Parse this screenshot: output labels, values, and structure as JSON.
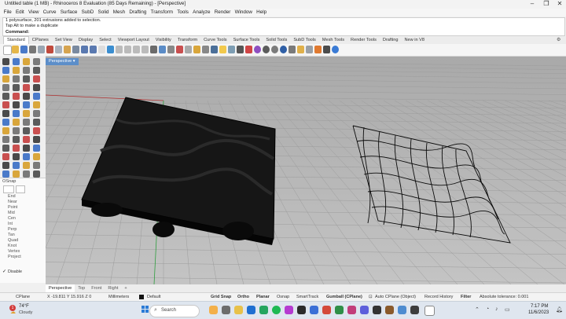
{
  "window": {
    "title": "Untitled table (1 MB) - Rhinoceros 8 Evaluation (85 Days Remaining) - [Perspective]",
    "controls": [
      "–",
      "❐",
      "✕"
    ]
  },
  "menu": [
    "File",
    "Edit",
    "View",
    "Curve",
    "Surface",
    "SubD",
    "Solid",
    "Mesh",
    "Drafting",
    "Transform",
    "Tools",
    "Analyze",
    "Render",
    "Window",
    "Help"
  ],
  "command_history": [
    "1 polysurface, 201 extrusions added to selection.",
    "Tap Alt to make a duplicate"
  ],
  "command_prompt": "Command:",
  "toolbar_tabs": [
    "Standard",
    "CPlanes",
    "Set View",
    "Display",
    "Select",
    "Viewport Layout",
    "Visibility",
    "Transform",
    "Curve Tools",
    "Surface Tools",
    "Solid Tools",
    "SubD Tools",
    "Mesh Tools",
    "Render Tools",
    "Drafting",
    "New in V8"
  ],
  "viewport": {
    "label": "Perspective"
  },
  "osnap": {
    "title": "OSnap",
    "items": [
      "End",
      "Near",
      "Point",
      "Mid",
      "Cen",
      "Int",
      "Perp",
      "Tan",
      "Quad",
      "Knot",
      "Vertex",
      "Project"
    ],
    "disable_label": "Disable"
  },
  "viewport_tabs": [
    "Perspective",
    "Top",
    "Front",
    "Right",
    "+"
  ],
  "status": {
    "cplane": "CPlane",
    "coords": "X -19.811 Y 15.916 Z 0",
    "units": "Millimeters",
    "layer": "Default",
    "toggles": [
      "Grid Snap",
      "Ortho",
      "Planar",
      "Osnap",
      "SmartTrack",
      "Gumball (CPlane)",
      "Auto CPlane (Object)",
      "Record History",
      "Filter"
    ],
    "tolerance": "Absolute tolerance: 0.001"
  },
  "taskbar": {
    "weather_temp": "74°F",
    "weather_desc": "Cloudy",
    "weather_badge": "1",
    "search_placeholder": "Search",
    "time": "7:17 PM",
    "date": "11/6/2023"
  },
  "colors": {
    "viewport_bg": "#b9b9b9",
    "viewport_label_bg": "#5c8ec9",
    "x_axis": "#b03030",
    "y_axis": "#2f9e3f",
    "taskbar_bg": "#dfe6ef"
  }
}
